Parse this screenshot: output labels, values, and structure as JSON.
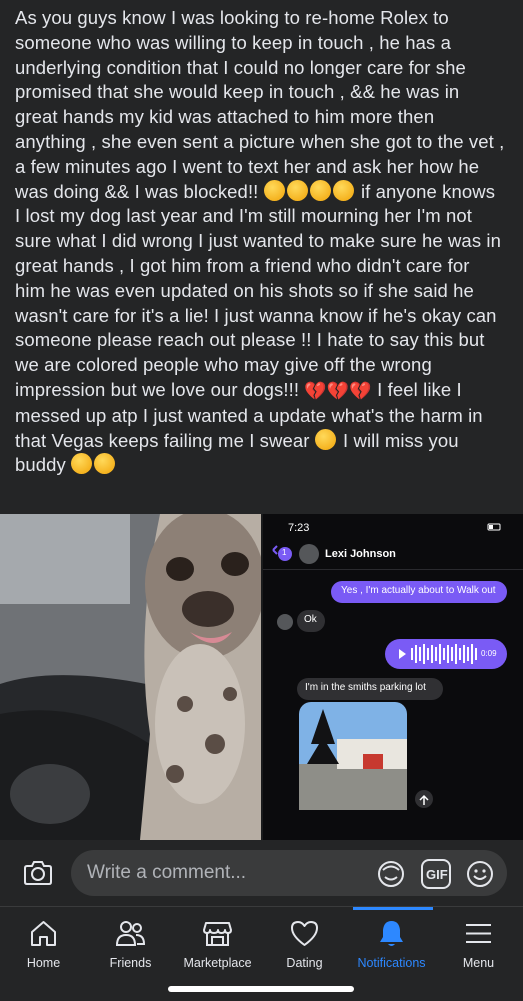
{
  "post": {
    "text_lines": [
      "As you guys know I was looking to re-home Rolex to",
      "someone who was willing to keep in touch , he has a",
      "underlying condition that I could no longer care for she",
      "promised that she would keep in touch , && he was in",
      "great hands my kid was attached to him more then",
      "anything , she even sent a picture when she got to the vet ,",
      "a few minutes ago I went to text her and ask her how he",
      "was doing && I was blocked!!",
      "if anyone knows",
      "I lost my dog last year and I'm still mourning her I'm not",
      "sure what I did wrong I just wanted to make sure he was in",
      "great hands , I got him from a friend who didn't care for",
      "him he was even updated on his shots so if she said he",
      "wasn't care for it's a lie! I just wanna know if he's okay can",
      "someone please reach out please !! I hate to say this but",
      "we are colored people who may give off the wrong",
      "impression but we love our dogs!!!",
      "I feel like I",
      "messed up atp I just wanted a update what's the harm in",
      "that Vegas keeps failing me I swear",
      "I will miss you",
      "buddy"
    ]
  },
  "screenshot": {
    "time": "7:23",
    "contact_name": "Lexi Johnson",
    "back_count": "1",
    "msg_sent_1": "Yes , I'm actually about to Walk out",
    "msg_recv_1": "Ok",
    "voice_duration": "0:09",
    "msg_recv_2": "I'm in the smiths parking lot"
  },
  "composer": {
    "placeholder": "Write a comment...",
    "gif_label": "GIF"
  },
  "tabs": [
    {
      "label": "Home",
      "icon": "home-icon"
    },
    {
      "label": "Friends",
      "icon": "friends-icon"
    },
    {
      "label": "Marketplace",
      "icon": "marketplace-icon"
    },
    {
      "label": "Dating",
      "icon": "dating-icon"
    },
    {
      "label": "Notifications",
      "icon": "bell-icon"
    },
    {
      "label": "Menu",
      "icon": "menu-icon"
    }
  ],
  "colors": {
    "background": "#242526",
    "text": "#e4e6eb",
    "accent": "#2d88ff",
    "messenger_bubble": "#7a5bf5"
  }
}
